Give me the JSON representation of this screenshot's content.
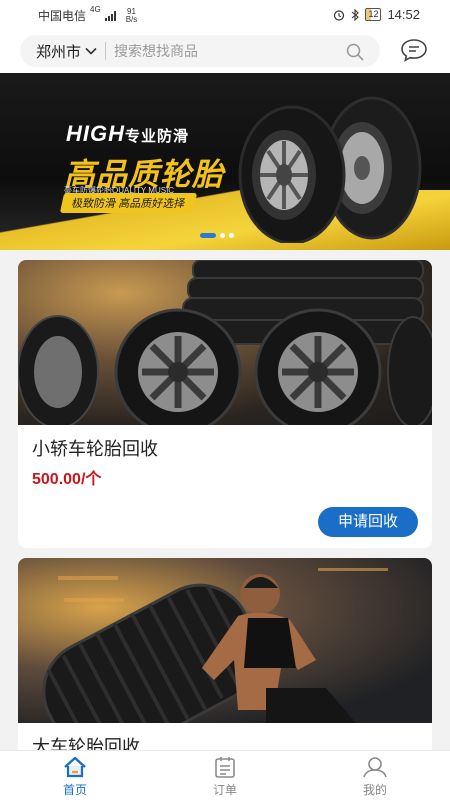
{
  "status_bar": {
    "carrier": "中国电信",
    "network": "4G",
    "speed_value": "91",
    "speed_unit": "B/s",
    "battery": "12",
    "time": "14:52"
  },
  "header": {
    "city": "郑州市",
    "search_placeholder": "搜索想找商品"
  },
  "banner": {
    "title_en": "HIGH",
    "title_tag": "专业防滑",
    "title_main": "高品质轮胎",
    "subtitle": "豪车防爆轮胎QUALITY MUSIC",
    "slogan": "极致防滑 高品质好选择",
    "slide_count": 3,
    "active_slide": 0
  },
  "products": [
    {
      "title": "小轿车轮胎回收",
      "price": "500.00/个",
      "button_label": "申请回收"
    },
    {
      "title": "大车轮胎回收"
    }
  ],
  "bottom_nav": {
    "items": [
      {
        "label": "首页",
        "icon": "home-icon",
        "active": true
      },
      {
        "label": "订单",
        "icon": "order-icon",
        "active": false
      },
      {
        "label": "我的",
        "icon": "profile-icon",
        "active": false
      }
    ]
  },
  "colors": {
    "accent": "#1a6ec8",
    "price": "#c8161d",
    "banner_yellow": "#f3c218"
  }
}
